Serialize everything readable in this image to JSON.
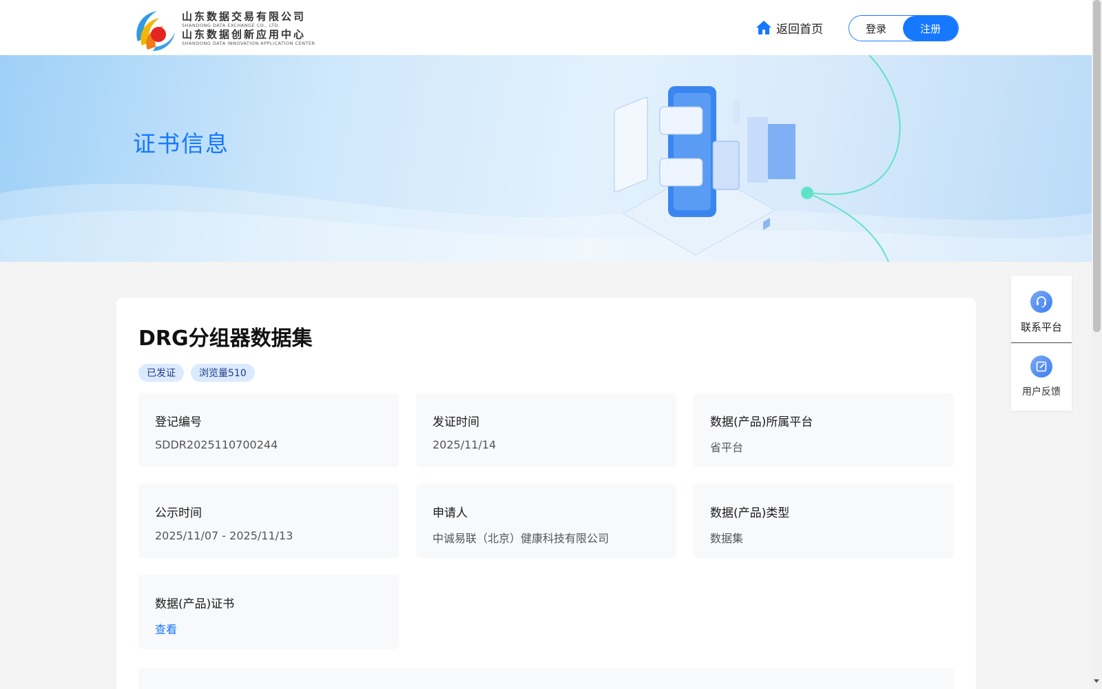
{
  "header": {
    "logo": {
      "line1_cn": "山东数据交易有限公司",
      "line1_en": "SHANDONG DATA EXCHANGE CO., LTD.",
      "line2_cn": "山东数据创新应用中心",
      "line2_en": "SHANDONG DATA INNOVATION APPLICATION CENTER"
    },
    "home_label": "返回首页",
    "login_label": "登录",
    "register_label": "注册"
  },
  "banner": {
    "title": "证书信息"
  },
  "card": {
    "title": "DRG分组器数据集",
    "tags": [
      "已发证",
      "浏览量510"
    ],
    "fields": [
      {
        "label": "登记编号",
        "value": "SDDR2025110700244"
      },
      {
        "label": "发证时间",
        "value": "2025/11/14"
      },
      {
        "label": "数据(产品)所属平台",
        "value": "省平台"
      },
      {
        "label": "公示时间",
        "value": "2025/11/07 - 2025/11/13"
      },
      {
        "label": "申请人",
        "value": "中诚易联（北京）健康科技有限公司"
      },
      {
        "label": "数据(产品)类型",
        "value": "数据集"
      },
      {
        "label": "数据(产品)证书",
        "value": "查看"
      }
    ]
  },
  "side_panel": {
    "contact_label": "联系平台",
    "feedback_label": "用户反馈"
  },
  "colors": {
    "accent": "#1677ff",
    "page_bg": "#f4f4f5",
    "tag_bg": "#dbeafe"
  },
  "icons": [
    "home-icon",
    "headset-icon",
    "edit-icon"
  ]
}
